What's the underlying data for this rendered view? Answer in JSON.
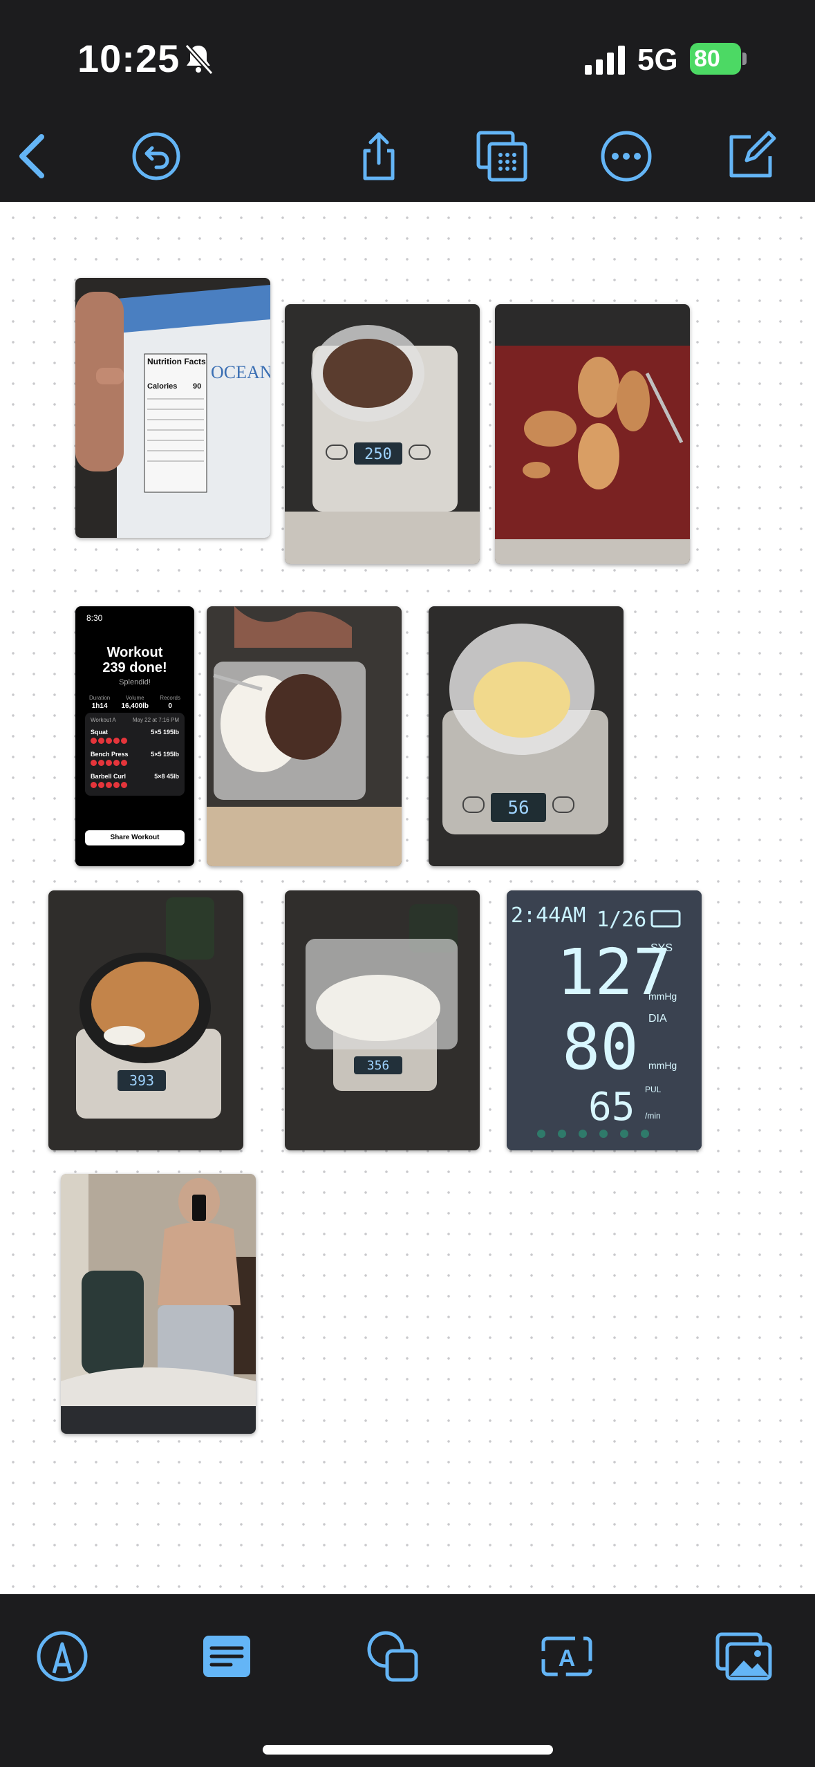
{
  "status_bar": {
    "time": "10:25",
    "network": "5G",
    "battery_level": "80"
  },
  "toolbar": {
    "icons": [
      "back-chevron-icon",
      "undo-icon",
      "share-icon",
      "pages-icon",
      "more-icon",
      "compose-icon"
    ]
  },
  "canvas": {
    "photos": [
      {
        "label": "nutrition-package-photo",
        "text": [
          "Nutrition Facts",
          "OCEAN",
          "90"
        ]
      },
      {
        "label": "shredded-beef-scale-photo",
        "scale_reading": "250"
      },
      {
        "label": "fish-fillets-plate-photo"
      },
      {
        "label": "workout-summary-screenshot"
      },
      {
        "label": "rice-and-beef-container-photo"
      },
      {
        "label": "shredded-cheese-scale-photo",
        "scale_reading": "56"
      },
      {
        "label": "chicken-bowl-scale-photo",
        "scale_reading": "393"
      },
      {
        "label": "rice-container-scale-photo",
        "scale_reading": "356"
      },
      {
        "label": "blood-pressure-monitor-photo"
      },
      {
        "label": "mirror-selfie-photo"
      }
    ],
    "workout": {
      "time": "8:30",
      "title_line1": "Workout",
      "title_line2": "239 done!",
      "subtitle": "Splendid!",
      "stats": [
        {
          "label": "Duration",
          "value": "1h14"
        },
        {
          "label": "Volume",
          "value": "16,400lb"
        },
        {
          "label": "Records",
          "value": "0"
        }
      ],
      "card_title": "Workout A",
      "card_date": "May 22 at 7:16 PM",
      "exercises": [
        {
          "name": "Squat",
          "sets": "5×5 195lb"
        },
        {
          "name": "Bench Press",
          "sets": "5×5 195lb"
        },
        {
          "name": "Barbell Curl",
          "sets": "5×8 45lb"
        }
      ],
      "share_label": "Share Workout"
    },
    "bp_monitor": {
      "time": "2:44AM",
      "date": "1/26",
      "sys": "127",
      "sys_label": "SYS",
      "dia": "80",
      "dia_label": "DIA",
      "pul": "65",
      "pul_label": "PUL",
      "unit": "mmHg",
      "pulse_unit": "/min"
    }
  },
  "bottom_bar": {
    "icons": [
      "markup-pen-icon",
      "text-box-icon",
      "shapes-icon",
      "text-style-icon",
      "photo-library-icon"
    ]
  },
  "colors": {
    "accent": "#64b5f6",
    "bar_background": "#1c1c1e",
    "battery_green": "#4cd964"
  }
}
